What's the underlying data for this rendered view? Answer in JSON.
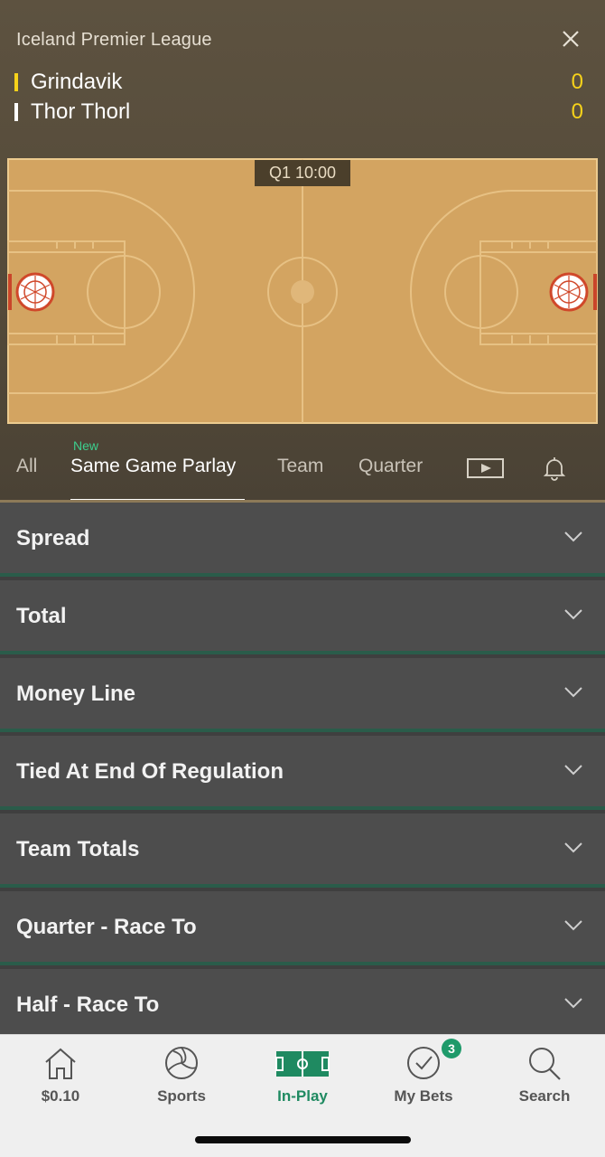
{
  "header": {
    "league": "Iceland Premier League",
    "teams": [
      {
        "name": "Grindavik",
        "score": "0",
        "marker_color": "#f7d21a"
      },
      {
        "name": "Thor Thorl",
        "score": "0",
        "marker_color": "#ffffff"
      }
    ],
    "clock": {
      "period": "Q1",
      "time": "10:00",
      "display": "Q1  10:00"
    }
  },
  "tabs": {
    "items": [
      "All",
      "Same Game Parlay",
      "Team",
      "Quarter"
    ],
    "new_badge": "New",
    "active": "Same Game Parlay"
  },
  "markets": [
    "Spread",
    "Total",
    "Money Line",
    "Tied At End Of Regulation",
    "Team Totals",
    "Quarter - Race To",
    "Half - Race To"
  ],
  "nav": {
    "items": [
      {
        "label": "$0.10",
        "icon": "home-icon"
      },
      {
        "label": "Sports",
        "icon": "volleyball-icon"
      },
      {
        "label": "In-Play",
        "icon": "pitch-icon"
      },
      {
        "label": "My Bets",
        "icon": "check-circle-icon"
      },
      {
        "label": "Search",
        "icon": "search-icon"
      }
    ],
    "active": "In-Play",
    "my_bets_badge": "3"
  },
  "colors": {
    "accent": "#1f8a61",
    "score": "#f7d21a",
    "court": "#d3a461",
    "divider": "#2a5c4a"
  }
}
